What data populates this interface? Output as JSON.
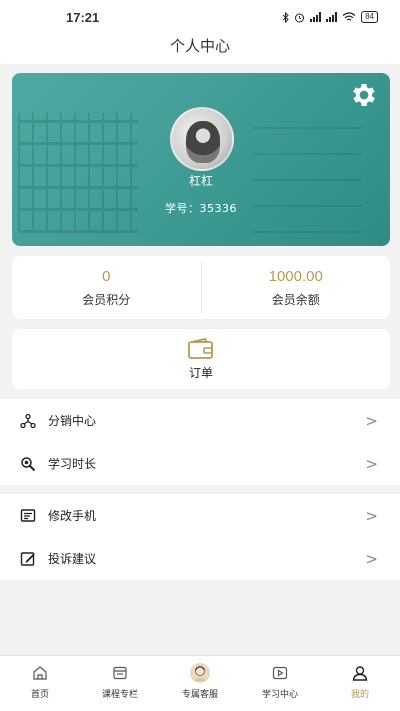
{
  "status_bar": {
    "time": "17:21",
    "battery": "84"
  },
  "header": {
    "title": "个人中心"
  },
  "profile": {
    "name": "杠杠",
    "student_id": "学号：35336"
  },
  "stats": [
    {
      "value": "0",
      "label": "会员积分"
    },
    {
      "value": "1000.00",
      "label": "会员余额"
    }
  ],
  "order": {
    "label": "订单",
    "icon": "wallet-icon"
  },
  "menu_group_1": [
    {
      "label": "分销中心",
      "icon": "distribution-icon",
      "arrow": ">"
    },
    {
      "label": "学习时长",
      "icon": "study-time-search-icon",
      "arrow": ">"
    }
  ],
  "menu_group_2": [
    {
      "label": "修改手机",
      "icon": "phone-edit-icon",
      "arrow": ">"
    },
    {
      "label": "投诉建议",
      "icon": "complaint-edit-icon",
      "arrow": ">"
    }
  ],
  "tabbar": [
    {
      "label": "首页",
      "icon": "home-icon"
    },
    {
      "label": "课程专栏",
      "icon": "course-icon"
    },
    {
      "label": "专属客服",
      "icon": "service-avatar-icon"
    },
    {
      "label": "学习中心",
      "icon": "video-play-icon"
    },
    {
      "label": "我的",
      "icon": "user-icon",
      "active": true
    }
  ],
  "colors": {
    "accent": "#b49a53",
    "card_teal": "#45a39b",
    "background": "#f2f2f2"
  }
}
